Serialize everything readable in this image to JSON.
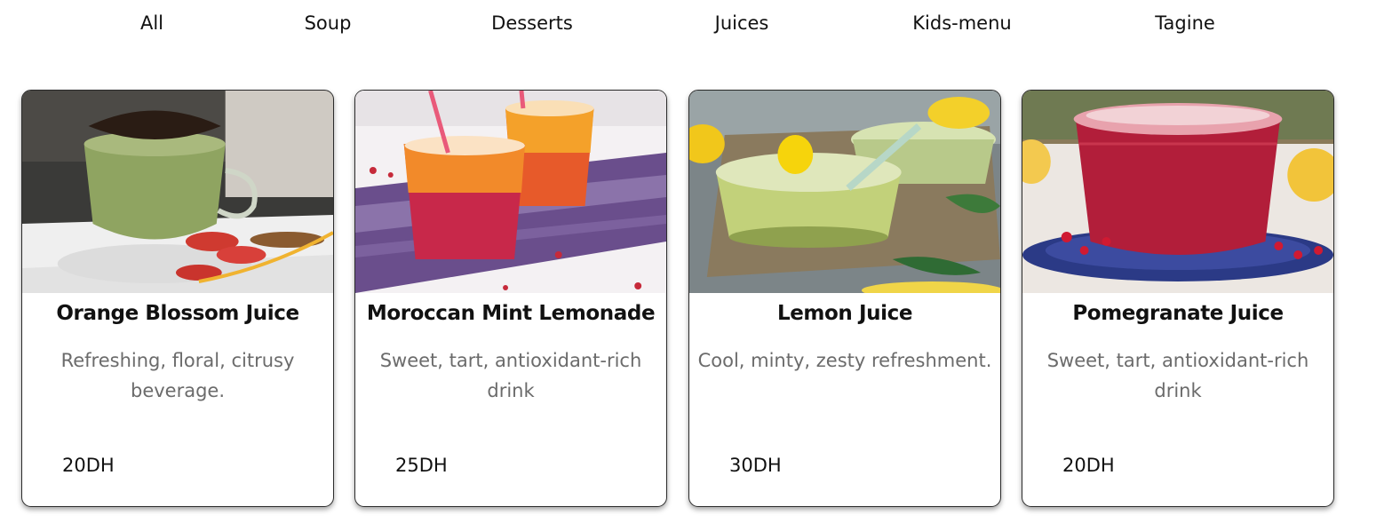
{
  "nav": {
    "items": [
      "All",
      "Soup",
      "Desserts",
      "Juices",
      "Kids-menu",
      "Tagine"
    ]
  },
  "products": [
    {
      "title": "Orange Blossom Juice",
      "description": "Refreshing, floral, citrusy beverage.",
      "price": "20DH"
    },
    {
      "title": "Moroccan Mint Lemonade",
      "description": "Sweet, tart, antioxidant-rich drink",
      "price": "25DH"
    },
    {
      "title": "Lemon Juice",
      "description": "Cool, minty, zesty refreshment.",
      "price": "30DH"
    },
    {
      "title": "Pomegranate Juice",
      "description": "Sweet, tart, antioxidant-rich drink",
      "price": "20DH"
    }
  ]
}
